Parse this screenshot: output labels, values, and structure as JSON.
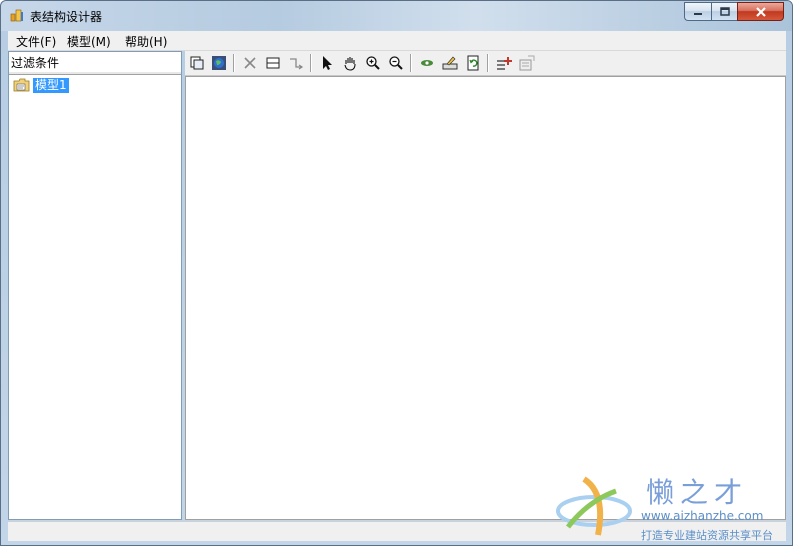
{
  "window": {
    "title": "表结构设计器"
  },
  "menu": {
    "items": [
      {
        "label": "文件(F)"
      },
      {
        "label": "模型(M)"
      },
      {
        "label": "帮助(H)"
      }
    ]
  },
  "left_panel": {
    "filter_label": "过滤条件",
    "tree": [
      {
        "label": "模型1",
        "selected": true
      }
    ]
  },
  "toolbar": {
    "icons": [
      "copy-icon",
      "globe-icon",
      "delete-icon",
      "table-icon",
      "relation-icon",
      "pointer-icon",
      "hand-icon",
      "zoom-in-icon",
      "zoom-out-icon",
      "eye-icon",
      "edit-icon",
      "refresh-icon",
      "add-field-icon",
      "properties-icon"
    ]
  },
  "watermark": {
    "brand": "懒之才",
    "url": "www.aizhanzhe.com",
    "slogan": "打造专业建站资源共享平台"
  },
  "colors": {
    "selection": "#3399ff",
    "close_button": "#c0391f",
    "watermark": "#5b8fc9"
  }
}
